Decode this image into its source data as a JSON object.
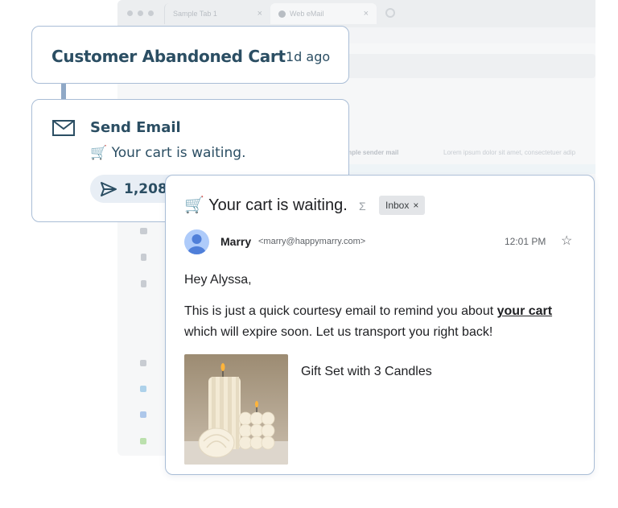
{
  "browser": {
    "tabs": [
      {
        "label": "Sample Tab 1",
        "close": "×"
      },
      {
        "label": "Web eMail",
        "close": "×"
      }
    ],
    "bg_row_sender": "mple sender mail",
    "bg_row_snippet": "Lorem ipsum dolor sit amet, consectetuer adip"
  },
  "trigger": {
    "title": "Customer Abandoned Cart",
    "time": "1d ago"
  },
  "send_email": {
    "title": "Send Email",
    "subject": "🛒 Your cart is waiting.",
    "sent_count": "1,208",
    "icon": "mail-icon",
    "sent_icon": "send-icon"
  },
  "email": {
    "subject": "🛒 Your cart is waiting.",
    "label_chip": "Inbox",
    "label_chip_close": "×",
    "sender_name": "Marry",
    "sender_email": "<marry@happymarry.com>",
    "time": "12:01 PM",
    "greeting": "Hey Alyssa,",
    "body_before_link": "This is just a quick courtesy email to remind you about ",
    "body_link": "your cart",
    "body_after_link": " which will expire soon. Let us transport you right back!",
    "product_name": "Gift Set with 3 Candles"
  },
  "colors": {
    "accent": "#2b4e63",
    "card_border": "#a9bdd6",
    "pill_bg": "#e8eef5"
  }
}
